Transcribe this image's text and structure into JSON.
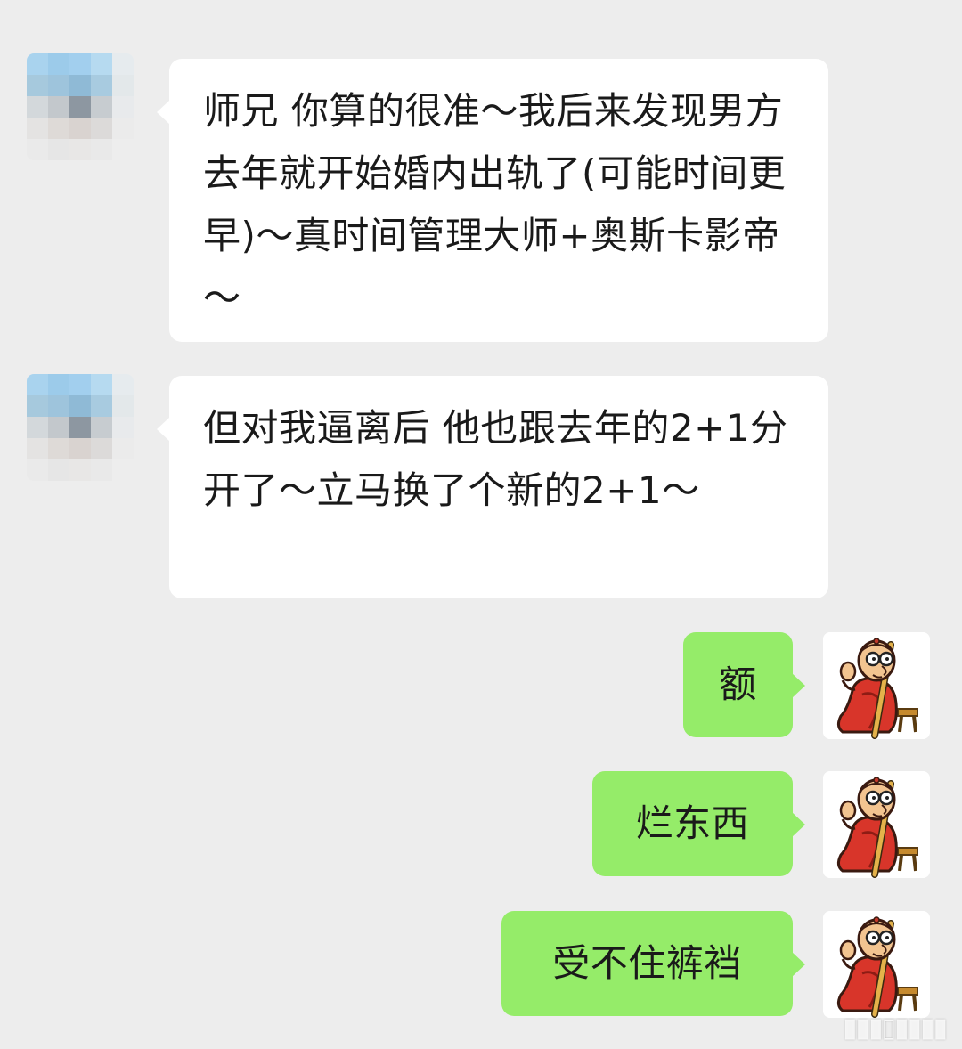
{
  "chat": {
    "messages": [
      {
        "sender": "contact",
        "text": "师兄 你算的很准～我后来发现男方去年就开始婚内出轨了(可能时间更早)～真时间管理大师+奥斯卡影帝～"
      },
      {
        "sender": "contact",
        "text": "但对我逼离后 他也跟去年的2+1分开了～立马换了个新的2+1～"
      },
      {
        "sender": "me",
        "text": "额"
      },
      {
        "sender": "me",
        "text": "烂东西"
      },
      {
        "sender": "me",
        "text": "受不住裤裆"
      }
    ]
  },
  "avatars": {
    "contact": "blurred-contact-avatar",
    "me": "cartoon-monk-avatar"
  },
  "colors": {
    "background": "#ededed",
    "incoming_bubble": "#ffffff",
    "outgoing_bubble": "#95ec69",
    "text": "#1a1a1a"
  }
}
